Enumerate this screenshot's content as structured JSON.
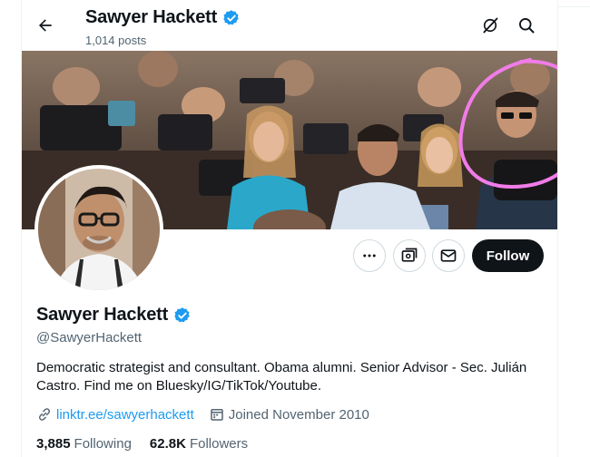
{
  "header": {
    "name": "Sawyer Hackett",
    "posts_count": "1,014 posts",
    "back_icon": "back-arrow-icon",
    "grok_icon": "grok-icon",
    "search_icon": "search-icon"
  },
  "profile": {
    "display_name": "Sawyer Hackett",
    "handle": "@SawyerHackett",
    "verified": true,
    "bio": "Democratic strategist and consultant. Obama alumni. Senior Advisor - Sec. Julián Castro. Find me on Bluesky/IG/TikTok/Youtube.",
    "link": "linktr.ee/sawyerhackett",
    "joined": "Joined November 2010",
    "following_count": "3,885",
    "following_label": "Following",
    "followers_count": "62.8K",
    "followers_label": "Followers"
  },
  "actions": {
    "more_icon": "more-icon",
    "subscribe_icon": "subscribe-icon",
    "message_icon": "message-icon",
    "follow_label": "Follow"
  },
  "colors": {
    "accent": "#1d9bf0",
    "text": "#0f1419",
    "muted": "#536471",
    "annotation_circle": "#f07ce8"
  }
}
